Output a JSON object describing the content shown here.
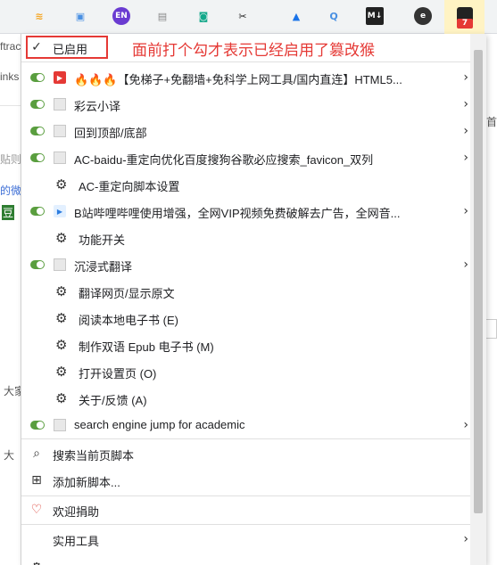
{
  "extensions": [
    {
      "name": "rss",
      "glyph": "≋",
      "color": "#f5a623"
    },
    {
      "name": "image",
      "glyph": "▣",
      "color": "#4a90e2"
    },
    {
      "name": "translate-en",
      "glyph": "EN",
      "color": "#ffffff",
      "bg": "#6a3bd1"
    },
    {
      "name": "document",
      "glyph": "▤",
      "color": "#888888"
    },
    {
      "name": "screenshot",
      "glyph": "◙",
      "color": "#13a88a"
    },
    {
      "name": "scissors",
      "glyph": "✂",
      "color": "#222222"
    },
    {
      "name": "triangle",
      "glyph": "▲",
      "color": "#1a73e8"
    },
    {
      "name": "search-q",
      "glyph": "Q",
      "color": "#4a90e2"
    },
    {
      "name": "markdown",
      "glyph": "M↓",
      "color": "#ffffff",
      "bg": "#222222"
    },
    {
      "name": "e-circle",
      "glyph": "e",
      "color": "#ffffff",
      "bg": "#333333"
    },
    {
      "name": "tampermonkey",
      "glyph": "7",
      "badge": "7"
    }
  ],
  "background": {
    "frag1": "ftrac",
    "frag2": "inks",
    "frag3": "贴则",
    "frag4": "的微信",
    "frag5": "豆",
    "frag6": "大家",
    "frag7": "首",
    "frag8": "大"
  },
  "annotation": "面前打个勾才表示已经启用了篡改猴",
  "menu": {
    "enabled_label": "已启用",
    "scripts": [
      {
        "label": "🔥🔥🔥【免梯子+免翻墙+免科学上网工具/国内直连】HTML5...",
        "toggle": true,
        "icon": "youtube",
        "arrow": true
      },
      {
        "label": "彩云小译",
        "toggle": true,
        "icon": "doc",
        "arrow": true
      },
      {
        "label": "回到顶部/底部",
        "toggle": true,
        "icon": "doc",
        "arrow": true
      },
      {
        "label": "AC-baidu-重定向优化百度搜狗谷歌必应搜索_favicon_双列",
        "toggle": true,
        "icon": "doc",
        "arrow": true
      },
      {
        "label": "AC-重定向脚本设置",
        "toggle": false,
        "icon": "gear",
        "arrow": false
      },
      {
        "label": "B站哔哩哔哩使用增强，全网VIP视频免费破解去广告，全网音...",
        "toggle": true,
        "icon": "bili",
        "arrow": true
      },
      {
        "label": "功能开关",
        "toggle": false,
        "icon": "gear",
        "arrow": false
      },
      {
        "label": "沉浸式翻译",
        "toggle": true,
        "icon": "doc",
        "arrow": true
      },
      {
        "label": "翻译网页/显示原文",
        "toggle": false,
        "icon": "gear",
        "arrow": false
      },
      {
        "label": "阅读本地电子书 (E)",
        "toggle": false,
        "icon": "gear",
        "arrow": false
      },
      {
        "label": "制作双语 Epub 电子书 (M)",
        "toggle": false,
        "icon": "gear",
        "arrow": false
      },
      {
        "label": "打开设置页 (O)",
        "toggle": false,
        "icon": "gear",
        "arrow": false
      },
      {
        "label": "关于/反馈 (A)",
        "toggle": false,
        "icon": "gear",
        "arrow": false
      },
      {
        "label": "search engine jump for academic",
        "toggle": true,
        "icon": "doc",
        "arrow": true
      }
    ],
    "search_scripts": "搜索当前页脚本",
    "add_script": "添加新脚本...",
    "donate": "欢迎捐助",
    "utilities": "实用工具"
  }
}
